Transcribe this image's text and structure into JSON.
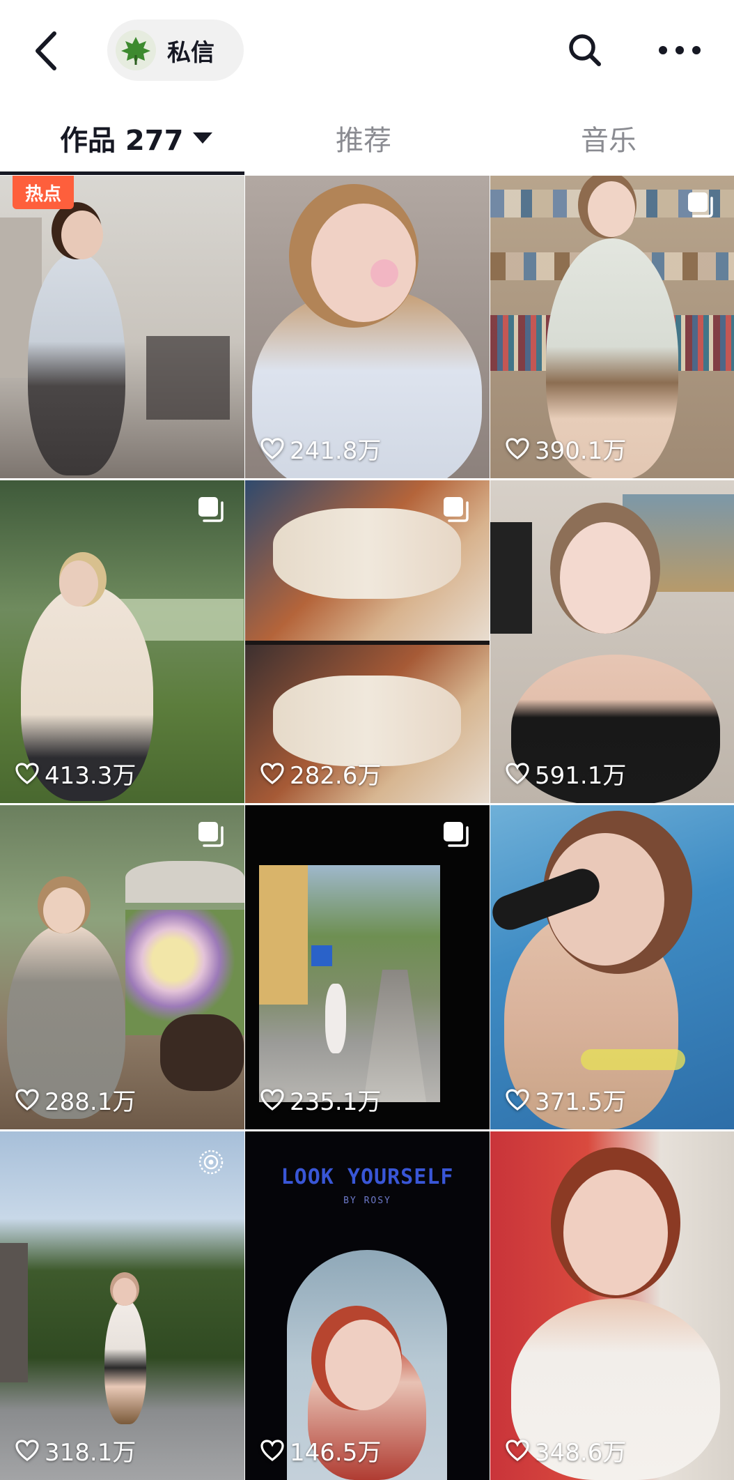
{
  "header": {
    "dm_label": "私信",
    "icons": {
      "back": "chevron-left-icon",
      "search": "search-icon",
      "more": "more-icon"
    }
  },
  "tabs": [
    {
      "label": "作品 277",
      "active": true
    },
    {
      "label": "推荐",
      "active": false
    },
    {
      "label": "音乐",
      "active": false
    }
  ],
  "colors": {
    "hot_badge": "#fe5f3c",
    "active_tab": "#161823",
    "inactive_tab": "#8a8b91"
  },
  "grid": [
    {
      "badge": "热点",
      "likes": "",
      "multi": false
    },
    {
      "likes": "241.8万",
      "multi": false
    },
    {
      "likes": "390.1万",
      "multi": true
    },
    {
      "likes": "413.3万",
      "multi": true
    },
    {
      "likes": "282.6万",
      "multi": true
    },
    {
      "likes": "591.1万",
      "multi": false
    },
    {
      "likes": "288.1万",
      "multi": true
    },
    {
      "likes": "235.1万",
      "multi": true
    },
    {
      "likes": "371.5万",
      "multi": false
    },
    {
      "likes": "318.1万",
      "live": true
    },
    {
      "likes": "146.5万",
      "title": "LOOK YOURSELF",
      "subtitle": "BY ROSY"
    },
    {
      "likes": "348.6万",
      "multi": false
    }
  ]
}
